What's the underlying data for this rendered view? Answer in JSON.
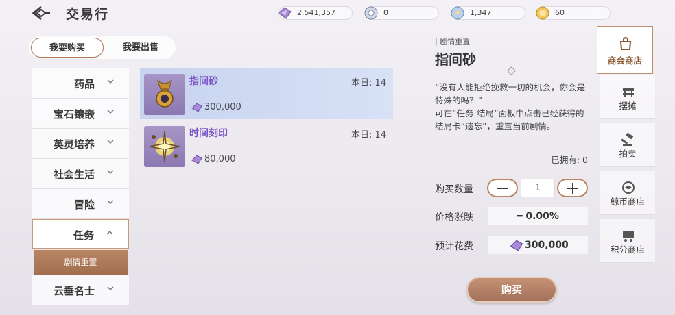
{
  "header": {
    "title": "交易行"
  },
  "currencies": [
    {
      "name": "purple-crystal",
      "value": "2,541,357"
    },
    {
      "name": "silver-coin",
      "value": "0"
    },
    {
      "name": "blue-crystal",
      "value": "1,347"
    },
    {
      "name": "gold-coin",
      "value": "60"
    }
  ],
  "mode_tabs": {
    "buy": "我要购买",
    "sell": "我要出售"
  },
  "categories": [
    "药品",
    "宝石镶嵌",
    "英灵培养",
    "社会生活",
    "冒险",
    "任务",
    "云垂名士"
  ],
  "subcategory": "剧情重置",
  "items": [
    {
      "name": "指间砂",
      "limit": "本日: 14",
      "price": "300,000"
    },
    {
      "name": "时间刻印",
      "limit": "本日: 14",
      "price": "80,000"
    }
  ],
  "detail": {
    "tag": "| 剧情重置",
    "name": "指间砂",
    "description": "“没有人能拒绝挽救一切的机会，你会是特殊的吗？”\n可在“任务-结局”面板中点击已经获得的结局卡“遗忘”，重置当前剧情。",
    "owned": "已拥有: 0",
    "qty_label": "购买数量",
    "qty_value": "1",
    "price_change_label": "价格涨跌",
    "price_change_value": "━ 0.00%",
    "cost_label": "预计花费",
    "cost_value": "300,000",
    "buy_label": "购买"
  },
  "right_nav": [
    "商会商店",
    "摆摊",
    "拍卖",
    "鲸币商店",
    "积分商店"
  ],
  "colors": {
    "accent": "#a3705a",
    "item_name": "#7b55c7",
    "selected_row": "#c7d3ef"
  }
}
